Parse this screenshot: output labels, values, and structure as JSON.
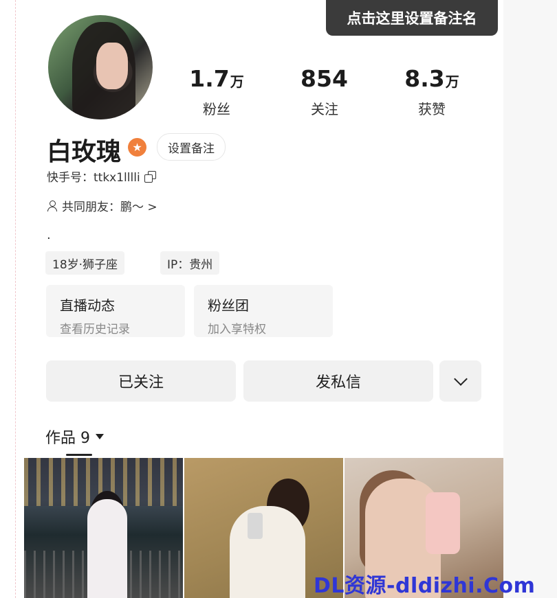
{
  "header": {
    "remark_tip": "点击这里设置备注名"
  },
  "profile": {
    "name": "白玫瑰",
    "remark_button": "设置备注",
    "kuaishou_id": "快手号：ttkx1lllli",
    "mutual_friends": "共同朋友：鹏～ >",
    "bio": "."
  },
  "stats": [
    {
      "number": "1.7",
      "unit": "万",
      "label": "粉丝"
    },
    {
      "number": "854",
      "unit": "",
      "label": "关注"
    },
    {
      "number": "8.3",
      "unit": "万",
      "label": "获赞"
    }
  ],
  "tags": [
    {
      "label": "18岁·狮子座"
    },
    {
      "label": "IP：贵州"
    }
  ],
  "cards": [
    {
      "title": "直播动态",
      "subtitle": "查看历史记录"
    },
    {
      "title": "粉丝团",
      "subtitle": "加入享特权"
    }
  ],
  "actions": {
    "followed": "已关注",
    "message": "发私信"
  },
  "works_tab": {
    "label": "作品 9"
  },
  "watermark": {
    "site_text": "DL资源-dldizhi.Com"
  },
  "icons": [
    "copy-icon",
    "person-icon",
    "chevron-down-icon",
    "dropdown-triangle-icon",
    "star-badge-icon"
  ],
  "colors": {
    "badge_orange": "#f0803c",
    "tip_bg": "#3b3b3b",
    "watermark_blue": "#2f36d6"
  }
}
